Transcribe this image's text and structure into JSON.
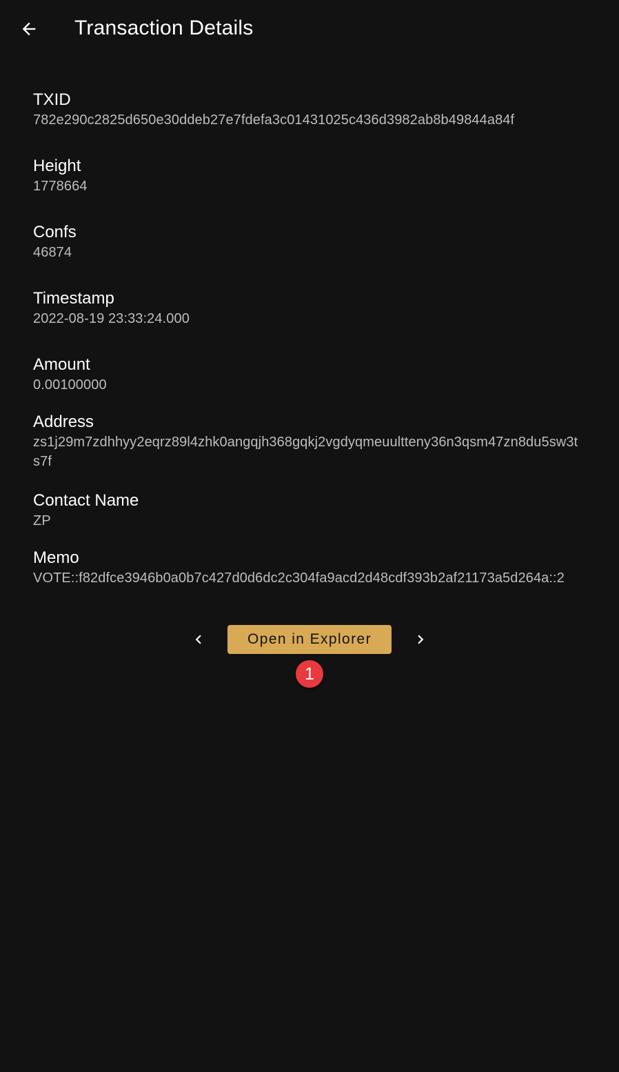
{
  "appbar": {
    "title": "Transaction Details",
    "back_icon": "arrow-left-icon"
  },
  "fields": {
    "txid": {
      "label": "TXID",
      "value": "782e290c2825d650e30ddeb27e7fdefa3c01431025c436d3982ab8b49844a84f"
    },
    "height": {
      "label": "Height",
      "value": "1778664"
    },
    "confs": {
      "label": "Confs",
      "value": "46874"
    },
    "timestamp": {
      "label": "Timestamp",
      "value": "2022-08-19 23:33:24.000"
    },
    "amount": {
      "label": "Amount",
      "value": "0.00100000"
    },
    "address": {
      "label": "Address",
      "value": "zs1j29m7zdhhyy2eqrz89l4zhk0angqjh368gqkj2vgdyqmeuultteny36n3qsm47zn8du5sw3ts7f"
    },
    "contact": {
      "label": "Contact Name",
      "value": "ZP"
    },
    "memo": {
      "label": "Memo",
      "value": "VOTE::f82dfce3946b0a0b7c427d0d6dc2c304fa9acd2d48cdf393b2af21173a5d264a::2"
    }
  },
  "actions": {
    "prev_icon": "chevron-left-icon",
    "explorer_label": "Open in Explorer",
    "next_icon": "chevron-right-icon",
    "badge": "1"
  },
  "colors": {
    "background": "#121212",
    "accent": "#d9aa55",
    "badge": "#e83a3f",
    "value_text": "#bdbdbd"
  }
}
